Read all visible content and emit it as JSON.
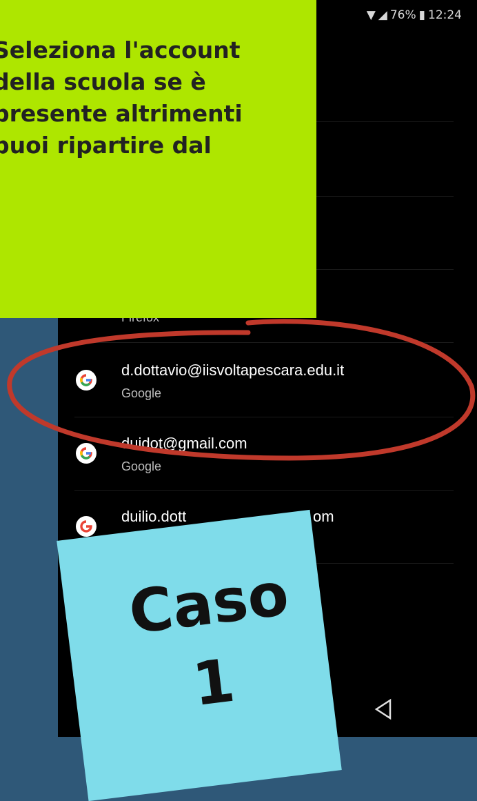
{
  "status_bar": {
    "battery": "76%",
    "time": "12:24"
  },
  "instruction": {
    "lines": [
      "Seleziona l'account",
      "della scuola se è",
      "presente altrimenti",
      "puoi ripartire dal"
    ]
  },
  "accounts": {
    "firefox_label": "Firefox",
    "items": [
      {
        "email": "d.dottavio@iisvoltapescara.edu.it",
        "provider": "Google"
      },
      {
        "email": "duidot@gmail.com",
        "provider": "Google"
      },
      {
        "email": "duilio.dott",
        "email_end": "om"
      }
    ]
  },
  "case_card": {
    "title": "Caso",
    "number": "1",
    "color": "#7fdcea"
  },
  "colors": {
    "instruction_bg": "#aee600",
    "highlight_stroke": "#c0392b",
    "side_bg": "#2f5878"
  },
  "icons": {
    "account": "google-icon",
    "back": "back-triangle-icon"
  }
}
